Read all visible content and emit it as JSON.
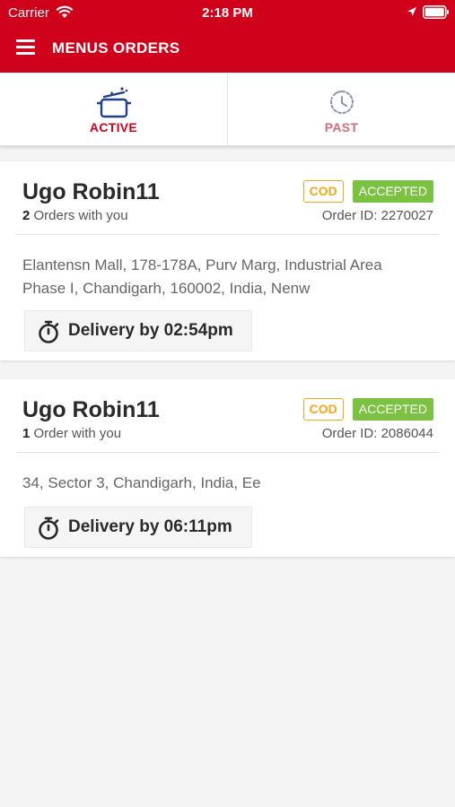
{
  "status_bar": {
    "carrier": "Carrier",
    "time": "2:18 PM"
  },
  "toolbar": {
    "title": "MENUS ORDERS",
    "menu_icon": "hamburger-menu-icon"
  },
  "tabs": [
    {
      "label": "ACTIVE",
      "icon": "cooking-pot-icon",
      "selected": true
    },
    {
      "label": "PAST",
      "icon": "history-clock-icon",
      "selected": false
    }
  ],
  "orders": [
    {
      "customer": "Ugo Robin11",
      "order_count": "2",
      "order_count_suffix": "Orders with you",
      "payment": "COD",
      "status": "ACCEPTED",
      "order_id": "Order ID: 2270027",
      "address": "Elantensn Mall,  178-178A,  Purv Marg, Industrial Area Phase I, Chandigarh, 160002, India,  Nenw",
      "delivery": "Delivery by 02:54pm"
    },
    {
      "customer": "Ugo Robin11",
      "order_count": "1",
      "order_count_suffix": "Order with you",
      "payment": "COD",
      "status": "ACCEPTED",
      "order_id": "Order ID: 2086044",
      "address": "34, Sector 3, Chandigarh, India, Ee",
      "delivery": "Delivery by 06:11pm"
    }
  ],
  "colors": {
    "brand": "#d0021b",
    "cod": "#f0a81c",
    "accepted": "#7cc242"
  }
}
